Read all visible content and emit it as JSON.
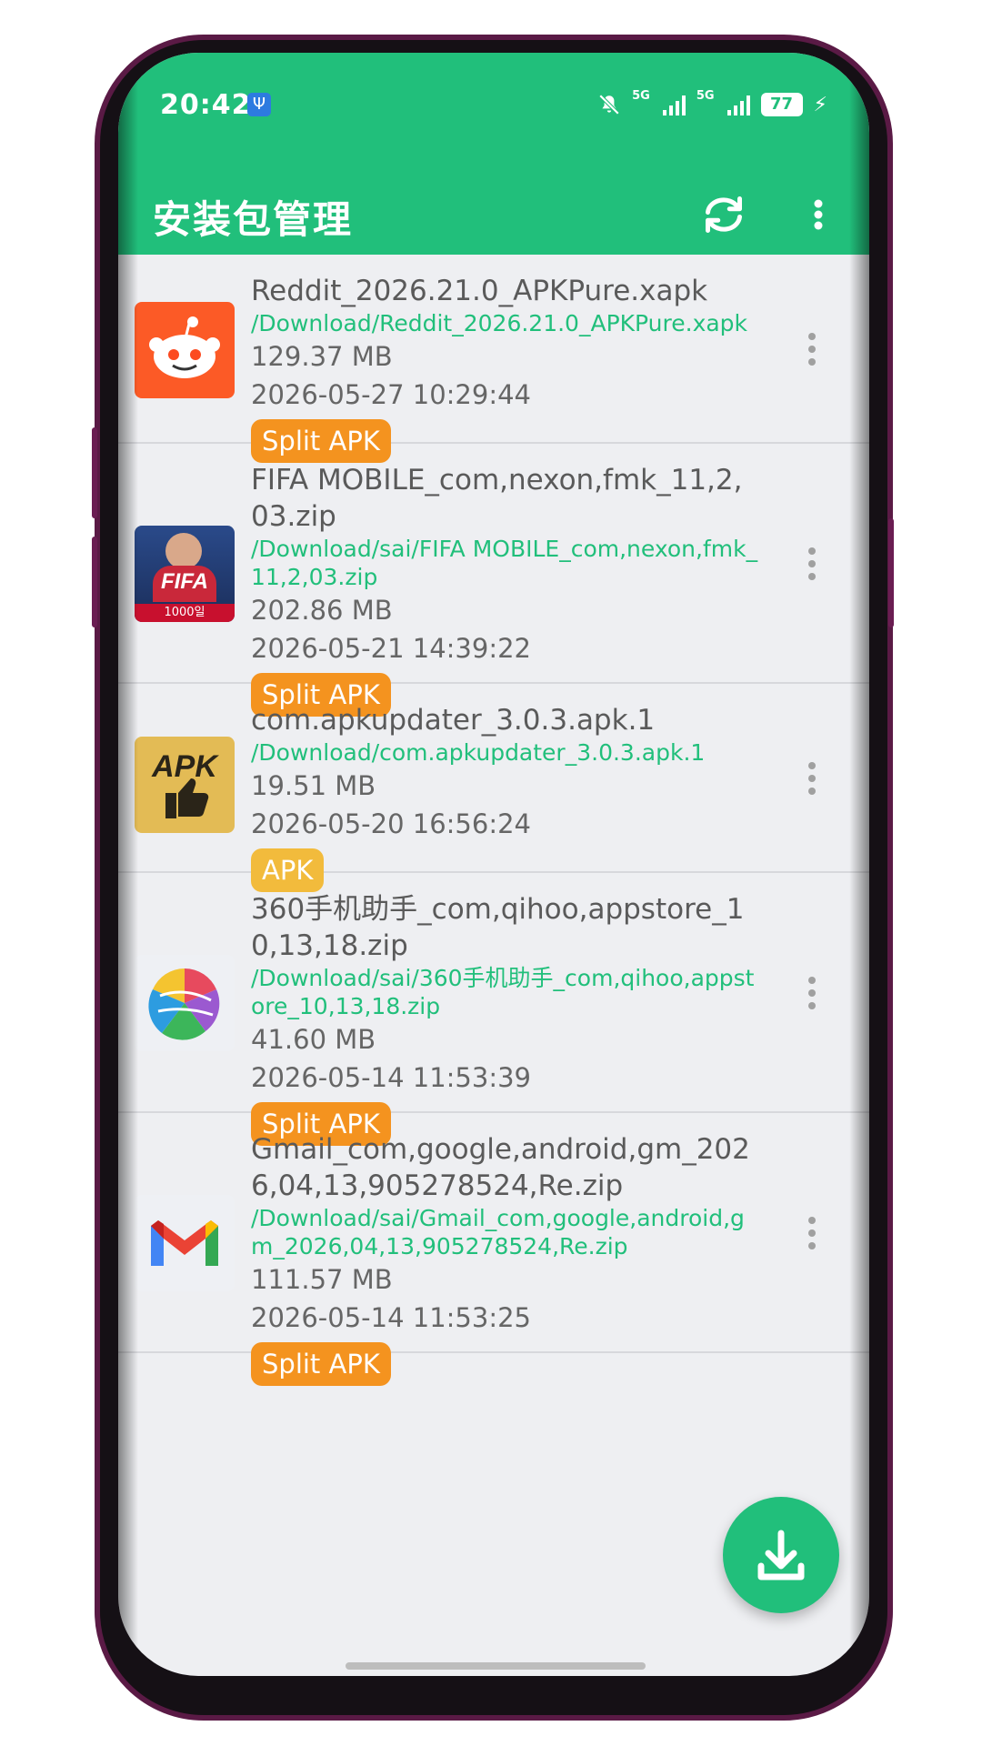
{
  "status_bar": {
    "time": "20:42",
    "signal1_label": "5G",
    "signal2_label": "5G",
    "battery": "77"
  },
  "header": {
    "title": "安装包管理"
  },
  "items": [
    {
      "name": "Reddit_2026.21.0_APKPure.xapk",
      "path": "/Download/Reddit_2026.21.0_APKPure.xapk",
      "size": "129.37 MB",
      "date": "2026-05-27 10:29:44",
      "tag": "Split APK",
      "icon": "reddit-icon"
    },
    {
      "name": "FIFA MOBILE_com,nexon,fmk_11,2,03.zip",
      "path": "/Download/sai/FIFA MOBILE_com,nexon,fmk_11,2,03.zip",
      "size": "202.86 MB",
      "date": "2026-05-21 14:39:22",
      "tag": "Split APK",
      "icon": "fifa-icon",
      "icon_text": "FIFA",
      "icon_subtext": "1000일"
    },
    {
      "name": "com.apkupdater_3.0.3.apk.1",
      "path": "/Download/com.apkupdater_3.0.3.apk.1",
      "size": "19.51 MB",
      "date": "2026-05-20 16:56:24",
      "tag": "APK",
      "icon": "apk-icon",
      "icon_text": "APK"
    },
    {
      "name": "360手机助手_com,qihoo,appstore_10,13,18.zip",
      "path": "/Download/sai/360手机助手_com,qihoo,appstore_10,13,18.zip",
      "size": "41.60 MB",
      "date": "2026-05-14 11:53:39",
      "tag": "Split APK",
      "icon": "360-appstore-icon"
    },
    {
      "name": "Gmail_com,google,android,gm_2026,04,13,905278524,Re.zip",
      "path": "/Download/sai/Gmail_com,google,android,gm_2026,04,13,905278524,Re.zip",
      "size": "111.57 MB",
      "date": "2026-05-14 11:53:25",
      "tag": "Split APK",
      "icon": "gmail-icon"
    }
  ],
  "colors": {
    "accent": "#21bf7b",
    "split_tag": "#f4931f",
    "apk_tag": "#f2bb3c"
  }
}
